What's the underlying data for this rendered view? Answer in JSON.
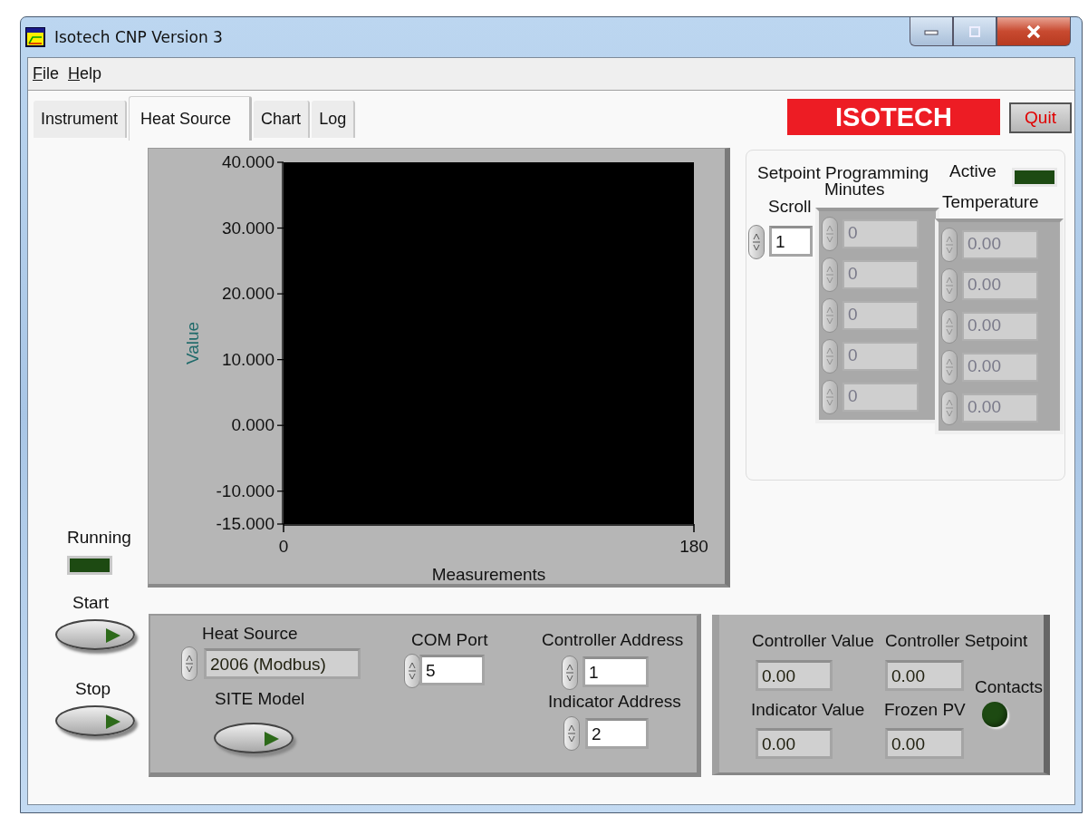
{
  "window": {
    "title": "Isotech CNP Version 3"
  },
  "menu": [
    "File",
    "Help"
  ],
  "tabs": [
    {
      "label": "Instrument",
      "selected": false
    },
    {
      "label": "Heat Source",
      "selected": true
    },
    {
      "label": "Chart",
      "selected": false
    },
    {
      "label": "Log",
      "selected": false
    }
  ],
  "logo": "ISOTECH",
  "quit_button": "Quit",
  "graph": {
    "chart_data": {
      "type": "line",
      "xlabel": "Measurements",
      "ylabel": "Value",
      "xlim": [
        0,
        180
      ],
      "ylim": [
        -15,
        40
      ],
      "xticks": [
        0,
        180
      ],
      "yticks": [
        {
          "value": 40,
          "label": "40.000"
        },
        {
          "value": 30,
          "label": "30.000"
        },
        {
          "value": 20,
          "label": "20.000"
        },
        {
          "value": 10,
          "label": "10.000"
        },
        {
          "value": 0,
          "label": "0.000"
        },
        {
          "value": -10,
          "label": "-10.000"
        },
        {
          "value": -15,
          "label": "-15.000"
        }
      ]
    }
  },
  "running": {
    "label": "Running",
    "on": false
  },
  "start_button": {
    "label": "Start"
  },
  "stop_button": {
    "label": "Stop"
  },
  "heat_source": {
    "label": "Heat Source",
    "value": "2006 (Modbus)"
  },
  "site_model": {
    "label": "SITE Model"
  },
  "com_port": {
    "label": "COM Port",
    "value": "5"
  },
  "controller_address": {
    "label": "Controller Address",
    "value": "1"
  },
  "indicator_address": {
    "label": "Indicator Address",
    "value": "2"
  },
  "readings": {
    "controller_value": {
      "label": "Controller Value",
      "value": "0.00"
    },
    "controller_setpoint": {
      "label": "Controller Setpoint",
      "value": "0.00"
    },
    "indicator_value": {
      "label": "Indicator Value",
      "value": "0.00"
    },
    "frozen_pv": {
      "label": "Frozen PV",
      "value": "0.00"
    },
    "contacts": {
      "label": "Contacts",
      "on": false
    }
  },
  "setpoint": {
    "title": "Setpoint Programming",
    "active": {
      "label": "Active",
      "on": false
    },
    "scroll": {
      "label": "Scroll",
      "value": "1"
    },
    "minutes": {
      "label": "Minutes",
      "disabled": true,
      "values": [
        "0",
        "0",
        "0",
        "0",
        "0"
      ]
    },
    "temperature": {
      "label": "Temperature",
      "disabled": true,
      "values": [
        "0.00",
        "0.00",
        "0.00",
        "0.00",
        "0.00"
      ]
    }
  }
}
